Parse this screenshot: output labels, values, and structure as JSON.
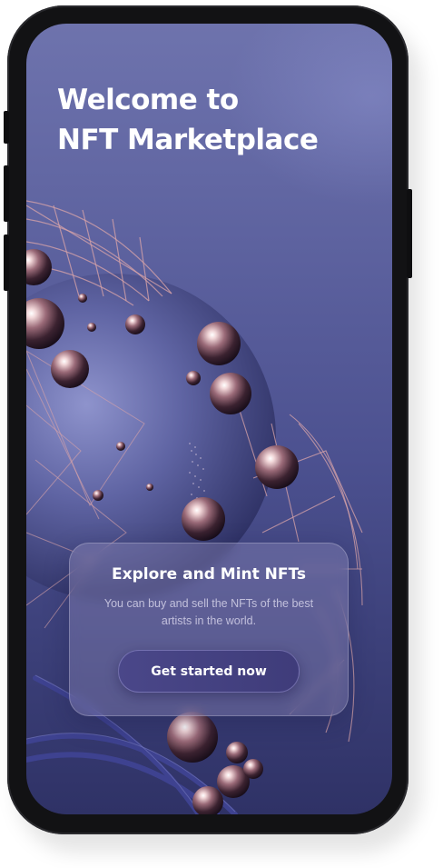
{
  "welcome": {
    "line1": "Welcome to",
    "line2": "NFT Marketplace"
  },
  "card": {
    "title": "Explore and Mint NFTs",
    "text": "You can buy and sell the NFTs of the best artists in the world.",
    "button_label": "Get started now"
  },
  "colors": {
    "background_top": "#6e73ad",
    "background_bottom": "#2f3266",
    "button": "#4a4789",
    "frame": "#121214"
  }
}
